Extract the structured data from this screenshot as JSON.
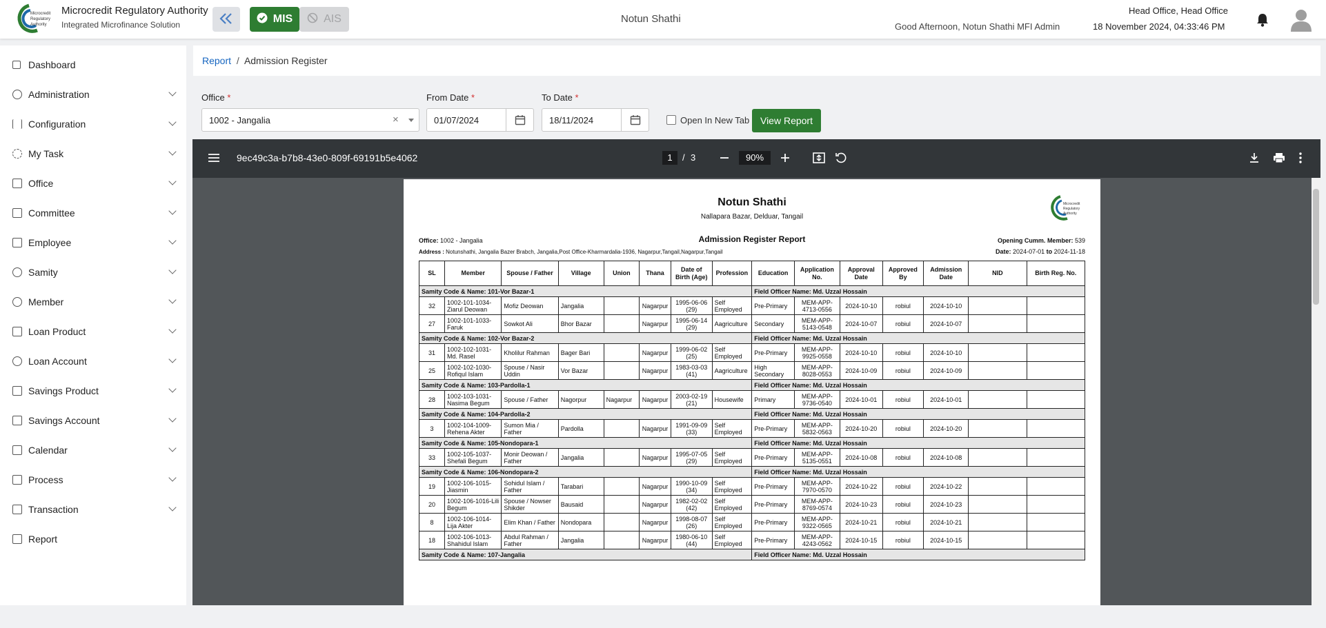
{
  "header": {
    "org_title": "Microcredit Regulatory Authority",
    "org_subtitle": "Integrated Microfinance Solution",
    "logo_text": "Microcredit Regulatory Authority",
    "mis_label": "MIS",
    "ais_label": "AIS",
    "center_title": "Notun Shathi",
    "greeting": "Good Afternoon, Notun Shathi MFI Admin",
    "office": "Head Office, Head Office",
    "datetime": "18 November 2024, 04:33:46 PM"
  },
  "sidebar": {
    "items": [
      {
        "label": "Dashboard",
        "expandable": false
      },
      {
        "label": "Administration",
        "expandable": true
      },
      {
        "label": "Configuration",
        "expandable": true
      },
      {
        "label": "My Task",
        "expandable": true
      },
      {
        "label": "Office",
        "expandable": true
      },
      {
        "label": "Committee",
        "expandable": true
      },
      {
        "label": "Employee",
        "expandable": true
      },
      {
        "label": "Samity",
        "expandable": true
      },
      {
        "label": "Member",
        "expandable": true
      },
      {
        "label": "Loan Product",
        "expandable": true
      },
      {
        "label": "Loan Account",
        "expandable": true
      },
      {
        "label": "Savings Product",
        "expandable": true
      },
      {
        "label": "Savings Account",
        "expandable": true
      },
      {
        "label": "Calendar",
        "expandable": true
      },
      {
        "label": "Process",
        "expandable": true
      },
      {
        "label": "Transaction",
        "expandable": true
      },
      {
        "label": "Report",
        "expandable": false
      }
    ]
  },
  "breadcrumb": {
    "root": "Report",
    "separator": "/",
    "current": "Admission Register"
  },
  "filters": {
    "office_label": "Office",
    "office_value": "1002 - Jangalia",
    "from_label": "From Date",
    "from_value": "01/07/2024",
    "to_label": "To Date",
    "to_value": "18/11/2024",
    "required_mark": "*",
    "new_tab_label": "Open In New Tab",
    "view_button": "View Report"
  },
  "pdf_toolbar": {
    "filename": "9ec49c3a-b7b8-43e0-809f-69191b5e4062",
    "page_current": "1",
    "page_sep": "/",
    "page_total": "3",
    "zoom": "90%"
  },
  "report": {
    "title": "Notun Shathi",
    "address": "Nallapara Bazar, Delduar, Tangail",
    "subtitle": "Admission Register Report",
    "office_label": "Office:",
    "office_value": "1002 - Jangalia",
    "opening_label": "Opening Cumm. Member:",
    "opening_value": "539",
    "address_label": "Address :",
    "address_value": "Notunshathi, Jangalia Bazer Brabch, Jangalia,Post Office-Kharmardalia-1936, Nagarpur,Tangail,Nagarpur,Tangail",
    "date_label": "Date:",
    "date_from": "2024-07-01",
    "date_to_word": "to",
    "date_to": "2024-11-18",
    "columns": [
      "SL",
      "Member",
      "Spouse / Father",
      "Village",
      "Union",
      "Thana",
      "Date of Birth (Age)",
      "Profession",
      "Education",
      "Application No.",
      "Approval Date",
      "Approved By",
      "Admission Date",
      "NID",
      "Birth Reg. No."
    ],
    "groups": [
      {
        "samity": "Samity Code & Name: 101-Vor Bazar-1",
        "officer": "Field Officer Name: Md. Uzzal Hossain",
        "rows": [
          [
            "32",
            "1002-101-1034-Ziarul Deowan",
            "Mofiz Deowan",
            "Jangalia",
            "",
            "Nagarpur",
            "1995-06-06 (29)",
            "Self Employed",
            "Pre-Primary",
            "MEM-APP-4713-0556",
            "2024-10-10",
            "robiul",
            "2024-10-10",
            "",
            ""
          ],
          [
            "27",
            "1002-101-1033-Faruk",
            "Sowkot Ali",
            "Bhor Bazar",
            "",
            "Nagarpur",
            "1995-06-14 (29)",
            "Aagriculture",
            "Secondary",
            "MEM-APP-5143-0548",
            "2024-10-07",
            "robiul",
            "2024-10-07",
            "",
            ""
          ]
        ]
      },
      {
        "samity": "Samity Code & Name: 102-Vor Bazar-2",
        "officer": "Field Officer Name: Md. Uzzal Hossain",
        "rows": [
          [
            "31",
            "1002-102-1031-Md. Rasel",
            "Kholilur Rahman",
            "Bager Bari",
            "",
            "Nagarpur",
            "1999-06-02 (25)",
            "Self Employed",
            "Pre-Primary",
            "MEM-APP-9925-0558",
            "2024-10-10",
            "robiul",
            "2024-10-10",
            "",
            ""
          ],
          [
            "25",
            "1002-102-1030-Rofiqul Islam",
            "Spouse / Nasir Uddin",
            "Vor Bazar",
            "",
            "Nagarpur",
            "1983-03-03 (41)",
            "Aagriculture",
            "High Secondary",
            "MEM-APP-8028-0553",
            "2024-10-09",
            "robiul",
            "2024-10-09",
            "",
            ""
          ]
        ]
      },
      {
        "samity": "Samity Code & Name: 103-Pardolla-1",
        "officer": "Field Officer Name: Md. Uzzal Hossain",
        "rows": [
          [
            "28",
            "1002-103-1031-Nasima Begum",
            "Spouse / Father",
            "Nagorpur",
            "Nagarpur",
            "Nagarpur",
            "2003-02-19 (21)",
            "Housewife",
            "Primary",
            "MEM-APP-9736-0540",
            "2024-10-01",
            "robiul",
            "2024-10-01",
            "",
            ""
          ]
        ]
      },
      {
        "samity": "Samity Code & Name: 104-Pardolla-2",
        "officer": "Field Officer Name: Md. Uzzal Hossain",
        "rows": [
          [
            "3",
            "1002-104-1009-Rehena Akter",
            "Sumon Mia / Father",
            "Pardolla",
            "",
            "Nagarpur",
            "1991-09-09 (33)",
            "Self Employed",
            "Pre-Primary",
            "MEM-APP-5832-0563",
            "2024-10-20",
            "robiul",
            "2024-10-20",
            "",
            ""
          ]
        ]
      },
      {
        "samity": "Samity Code & Name: 105-Nondopara-1",
        "officer": "Field Officer Name: Md. Uzzal Hossain",
        "rows": [
          [
            "33",
            "1002-105-1037-Shefali Begum",
            "Monir Deowan / Father",
            "Jangalia",
            "",
            "Nagarpur",
            "1995-07-05 (29)",
            "Self Employed",
            "Pre-Primary",
            "MEM-APP-5135-0551",
            "2024-10-08",
            "robiul",
            "2024-10-08",
            "",
            ""
          ]
        ]
      },
      {
        "samity": "Samity Code & Name: 106-Nondopara-2",
        "officer": "Field Officer Name: Md. Uzzal Hossain",
        "rows": [
          [
            "19",
            "1002-106-1015-Jiasmin",
            "Sohidul Islam / Father",
            "Tarabari",
            "",
            "Nagarpur",
            "1990-10-09 (34)",
            "Self Employed",
            "Pre-Primary",
            "MEM-APP-7970-0570",
            "2024-10-22",
            "robiul",
            "2024-10-22",
            "",
            ""
          ],
          [
            "20",
            "1002-106-1016-Lili Begum",
            "Spouse / Nowser Shikder",
            "Bausaid",
            "",
            "Nagarpur",
            "1982-02-02 (42)",
            "Self Employed",
            "Pre-Primary",
            "MEM-APP-8769-0574",
            "2024-10-23",
            "robiul",
            "2024-10-23",
            "",
            ""
          ],
          [
            "8",
            "1002-106-1014-Lija Akter",
            "Elim Khan / Father",
            "Nondopara",
            "",
            "Nagarpur",
            "1998-08-07 (26)",
            "Self Employed",
            "Pre-Primary",
            "MEM-APP-9322-0565",
            "2024-10-21",
            "robiul",
            "2024-10-21",
            "",
            ""
          ],
          [
            "18",
            "1002-106-1013-Shahidul Islam",
            "Abdul Rahman / Father",
            "Jangalia",
            "",
            "Nagarpur",
            "1980-06-10 (44)",
            "Self Employed",
            "Pre-Primary",
            "MEM-APP-4243-0562",
            "2024-10-15",
            "robiul",
            "2024-10-15",
            "",
            ""
          ]
        ]
      },
      {
        "samity": "Samity Code & Name: 107-Jangalia",
        "officer": "Field Officer Name: Md. Uzzal Hossain",
        "rows": []
      }
    ]
  },
  "colors": {
    "brand_green": "#2e7d32",
    "link_blue": "#1565c0",
    "pdf_toolbar": "#323639",
    "pdf_bg": "#525659"
  },
  "icons": [
    "collapse-chevrons-icon",
    "check-circle-icon",
    "blocked-icon",
    "bell-icon",
    "user-avatar-icon",
    "menu-icon",
    "zoom-out-icon",
    "zoom-in-icon",
    "fit-page-icon",
    "rotate-icon",
    "download-icon",
    "print-icon",
    "more-icon",
    "calendar-icon",
    "clear-icon",
    "dropdown-caret-icon"
  ]
}
